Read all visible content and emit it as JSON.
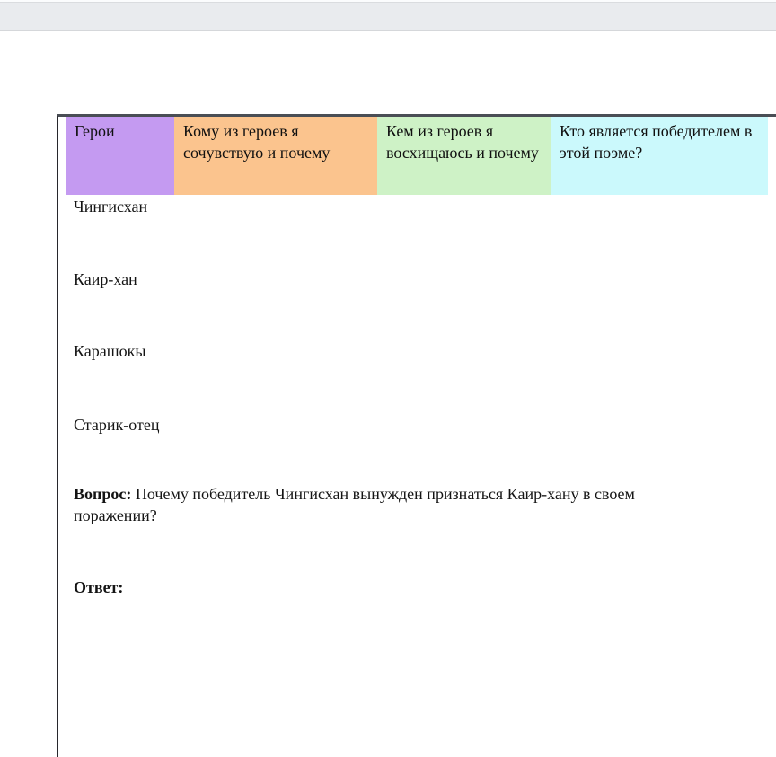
{
  "document": {
    "table": {
      "headers": [
        {
          "label": "Герои",
          "color": "#c49af1"
        },
        {
          "label": "Кому из героев я сочувствую и почему",
          "color": "#fbc48e"
        },
        {
          "label": "Кем из героев я восхищаюсь и почему",
          "color": "#cef2c6"
        },
        {
          "label": "Кто является победителем в этой поэме?",
          "color": "#cbf9fc"
        }
      ],
      "rows": [
        {
          "hero": "Чингисхан"
        },
        {
          "hero": "Каир-хан"
        },
        {
          "hero": "Карашокы"
        },
        {
          "hero": "Старик-отец"
        }
      ]
    },
    "question": {
      "label": "Вопрос:",
      "text": "Почему победитель Чингисхан вынужден признаться Каир-хану в своем поражении?"
    },
    "answer": {
      "label": "Ответ:"
    }
  }
}
